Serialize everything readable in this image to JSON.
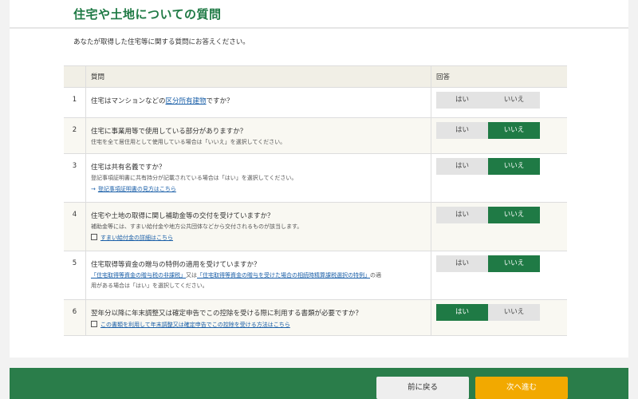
{
  "page_title": "住宅や土地についての質問",
  "intro": "あなたが取得した住宅等に関する質問にお答えください。",
  "table": {
    "header_question": "質問",
    "header_answer": "回答"
  },
  "answer_labels": {
    "yes": "はい",
    "no": "いいえ"
  },
  "questions": [
    {
      "num": "1",
      "text_before": "住宅はマンションなどの",
      "text_link": "区分所有建物",
      "text_after": "ですか？",
      "selected": "none"
    },
    {
      "num": "2",
      "text": "住宅に事業用等で使用している部分がありますか？",
      "note": "住宅を全て居住用として使用している場合は「いいえ」を選択してください。",
      "selected": "no"
    },
    {
      "num": "3",
      "text": "住宅は共有名義ですか？",
      "note": "登記事項証明書に共有持分が記載されている場合は「はい」を選択してください。",
      "link": "登記事項証明書の見方はこちら",
      "selected": "no"
    },
    {
      "num": "4",
      "text": "住宅や土地の取得に関し補助金等の交付を受けていますか？",
      "note": "補助金等には、すまい給付金や地方公共団体などから交付されるものが該当します。",
      "link": "すまい給付金の詳細はこちら",
      "selected": "no"
    },
    {
      "num": "5",
      "text": "住宅取得等資金の贈与の特例の適用を受けていますか？",
      "link1": "「住宅取得等資金の贈与税の非課税」",
      "mid": "又は",
      "link2": "「住宅取得等資金の贈与を受けた場合の相続時精算課税選択の特例」",
      "tail": "の適",
      "note2": "用がある場合は「はい」を選択してください。",
      "selected": "no"
    },
    {
      "num": "6",
      "text": "翌年分以降に年末調整又は確定申告でこの控除を受ける際に利用する書類が必要ですか？",
      "link": "この書類を利用して年末調整又は確定申告でこの控除を受ける方法はこちら",
      "selected": "yes"
    }
  ],
  "footer": {
    "back_label": "前に戻る",
    "next_label": "次へ進む"
  },
  "colors": {
    "accent_green": "#1f7a45",
    "footer_green": "#2a7d4a",
    "next_orange": "#f2a900"
  }
}
